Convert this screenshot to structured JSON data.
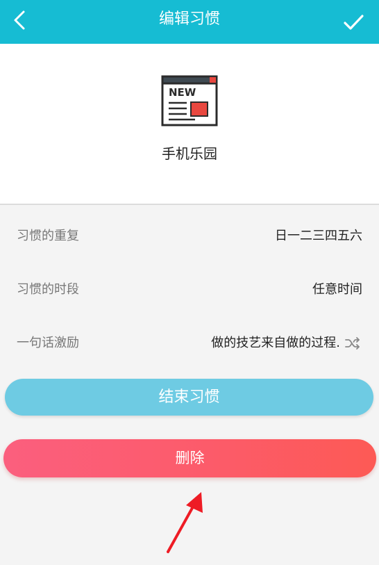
{
  "header": {
    "title": "编辑习惯",
    "back_icon": "back-chevron-icon",
    "confirm_icon": "checkmark-icon",
    "bg_color": "#16bcd3"
  },
  "habit": {
    "icon": "news-icon",
    "icon_text": "NEW",
    "name": "手机乐园"
  },
  "settings": {
    "repeat_label": "习惯的重复",
    "repeat_value": "日一二三四五六",
    "period_label": "习惯的时段",
    "period_value": "任意时间",
    "motto_label": "一句话激励",
    "motto_value": "做的技艺来自做的过程.",
    "motto_icon": "shuffle-icon"
  },
  "actions": {
    "end_label": "结束习惯",
    "delete_label": "删除",
    "end_color": "#6ecbe3",
    "delete_color": "#fc5b6a"
  },
  "annotation": {
    "arrow_color": "#ee1c25"
  }
}
